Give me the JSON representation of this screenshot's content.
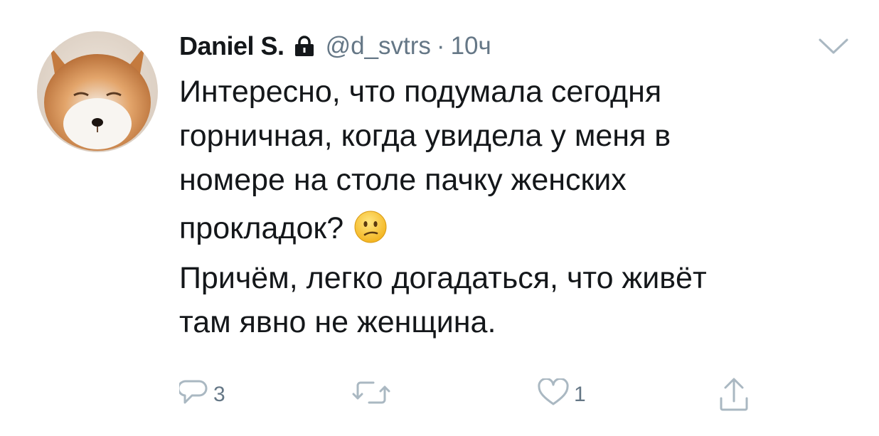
{
  "tweet": {
    "author_name": "Daniel S.",
    "handle": "@d_svtrs",
    "separator": "·",
    "time": "10ч",
    "text_lines": [
      "Интересно, что подумала сегодня",
      "горничная, когда увидела у меня в",
      "номере на столе пачку женских",
      "прокладок?",
      "Причём, легко догадаться, что живёт",
      "там явно не женщина."
    ],
    "emoji": "confused-face",
    "icons": {
      "avatar": "fox-avatar",
      "lock": "lock-icon",
      "menu": "chevron-down-icon"
    }
  },
  "actions": {
    "reply_count": "3",
    "retweet_count": "",
    "like_count": "1"
  },
  "colors": {
    "text": "#14171a",
    "secondary": "#657786",
    "icon": "#aab8c2"
  }
}
